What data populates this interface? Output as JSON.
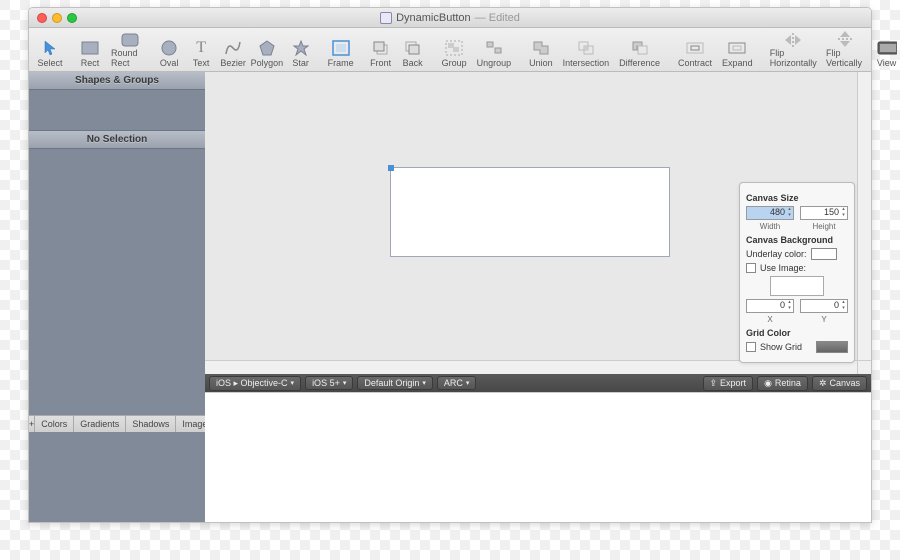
{
  "title": {
    "filename": "DynamicButton",
    "status": "— Edited"
  },
  "toolbar": {
    "select": "Select",
    "rect": "Rect",
    "roundrect": "Round Rect",
    "oval": "Oval",
    "text": "Text",
    "bezier": "Bezier",
    "polygon": "Polygon",
    "star": "Star",
    "frame": "Frame",
    "front": "Front",
    "back": "Back",
    "group": "Group",
    "ungroup": "Ungroup",
    "union": "Union",
    "intersection": "Intersection",
    "difference": "Difference",
    "contract": "Contract",
    "expand": "Expand",
    "fliph": "Flip Horizontally",
    "flipv": "Flip Vertically",
    "view": "View"
  },
  "leftpanel": {
    "header1": "Shapes & Groups",
    "header2": "No Selection",
    "plus": "+",
    "tabs": [
      "Colors",
      "Gradients",
      "Shadows",
      "Images"
    ]
  },
  "inspector": {
    "canvas_size_title": "Canvas Size",
    "width_value": "480",
    "width_label": "Width",
    "height_value": "150",
    "height_label": "Height",
    "bg_title": "Canvas Background",
    "underlay_label": "Underlay color:",
    "useimage_label": "Use Image:",
    "x_value": "0",
    "x_label": "X",
    "y_value": "0",
    "y_label": "Y",
    "gridcolor_title": "Grid Color",
    "showgrid_label": "Show Grid"
  },
  "statusbar": {
    "platform": "iOS ▸ Objective-C",
    "os": "iOS 5+",
    "origin": "Default Origin",
    "arc": "ARC",
    "export": "Export",
    "retina": "Retina",
    "canvas": "Canvas"
  },
  "icons": {
    "export": "⇪",
    "retina": "◉",
    "canvas": "✲"
  }
}
